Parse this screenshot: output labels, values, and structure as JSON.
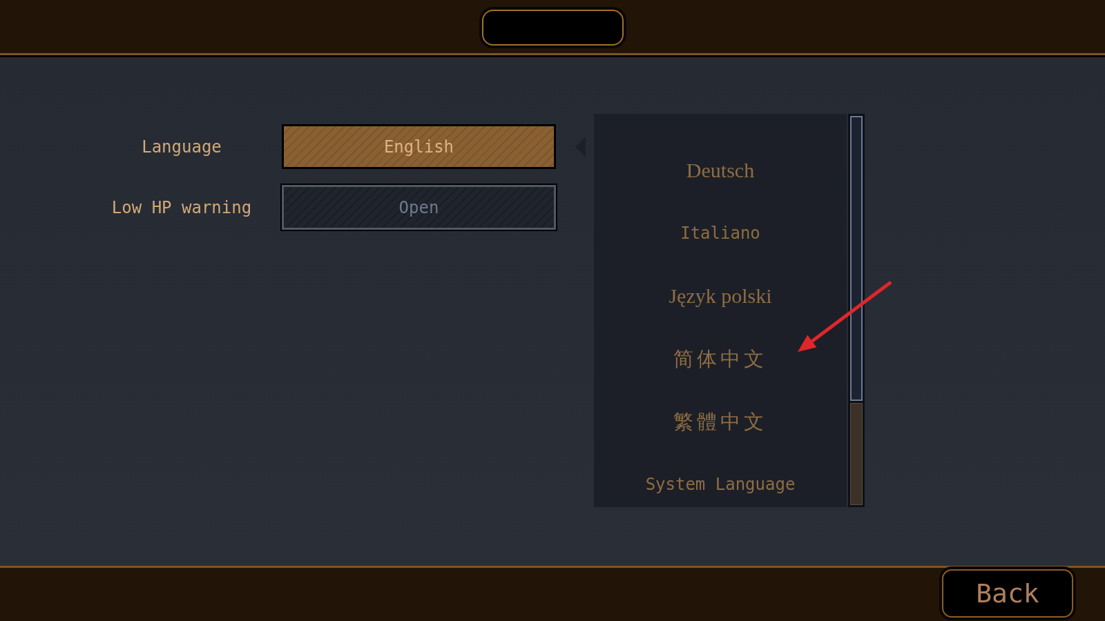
{
  "settings": [
    {
      "label": "Language",
      "value": "English",
      "expanded": true
    },
    {
      "label": "Low HP warning",
      "value": "Open",
      "expanded": false
    }
  ],
  "language_list": {
    "items": [
      {
        "label": "Deutsch",
        "kind": "serif"
      },
      {
        "label": "Italiano",
        "kind": "pixel"
      },
      {
        "label": "Język polski",
        "kind": "serif"
      },
      {
        "label": "简体中文",
        "kind": "cjk"
      },
      {
        "label": "繁體中文",
        "kind": "cjk"
      },
      {
        "label": "System Language",
        "kind": "pixel"
      }
    ]
  },
  "back_button": {
    "label": "Back"
  }
}
